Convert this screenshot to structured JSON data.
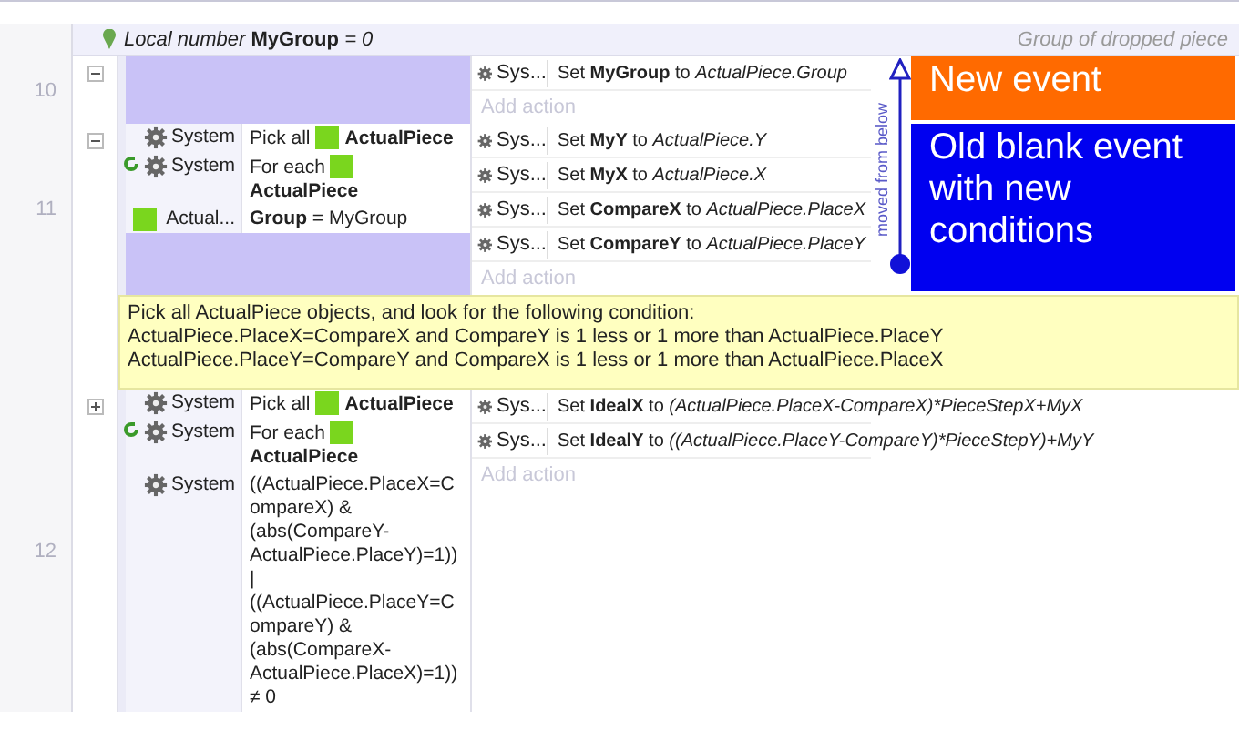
{
  "local_variable": {
    "label": "Local number",
    "name": "MyGroup",
    "value": "= 0",
    "comment": "Group of dropped piece"
  },
  "events": [
    {
      "kind": "event",
      "number": "10",
      "expanded": true,
      "actions": [
        {
          "object": "Sys...",
          "verb": "Set",
          "target": "MyGroup",
          "to": "to",
          "value": "ActualPiece.Group"
        }
      ],
      "add_action": "Add action",
      "note": {
        "kind": "orange",
        "text": "New event"
      }
    },
    {
      "kind": "event",
      "number": "11",
      "expanded": true,
      "conditions": [
        {
          "kind": "system",
          "object": "System",
          "loop": false,
          "prefix": "Pick all",
          "param": "ActualPiece"
        },
        {
          "kind": "system",
          "object": "System",
          "loop": true,
          "prefix": "For each",
          "param": "ActualPiece"
        },
        {
          "kind": "sprite",
          "object": "Actual...",
          "loop": false,
          "text": "**Group** = MyGroup"
        }
      ],
      "actions": [
        {
          "object": "Sys...",
          "verb": "Set",
          "target": "MyY",
          "to": "to",
          "value": "ActualPiece.Y"
        },
        {
          "object": "Sys...",
          "verb": "Set",
          "target": "MyX",
          "to": "to",
          "value": "ActualPiece.X"
        },
        {
          "object": "Sys...",
          "verb": "Set",
          "target": "CompareX",
          "to": "to",
          "value": "ActualPiece.PlaceX"
        },
        {
          "object": "Sys...",
          "verb": "Set",
          "target": "CompareY",
          "to": "to",
          "value": "ActualPiece.PlaceY"
        }
      ],
      "add_action": "Add action",
      "note": {
        "kind": "blue",
        "text": "Old blank event with new conditions"
      }
    },
    {
      "kind": "comment",
      "lines": [
        "Pick all ActualPiece objects, and look for the following condition:",
        "ActualPiece.PlaceX=CompareX and CompareY is 1 less or 1 more than ActualPiece.PlaceY",
        "ActualPiece.PlaceY=CompareY and CompareX is 1 less or 1 more than ActualPiece.PlaceX"
      ]
    },
    {
      "kind": "event",
      "number": "12",
      "expanded": false,
      "conditions": [
        {
          "kind": "system",
          "object": "System",
          "loop": false,
          "prefix": "Pick all",
          "param": "ActualPiece"
        },
        {
          "kind": "system",
          "object": "System",
          "loop": true,
          "prefix": "For each",
          "param": "ActualPiece"
        },
        {
          "kind": "system",
          "object": "System",
          "loop": false,
          "text": "((ActualPiece.PlaceX=CompareX) & (abs(CompareY-ActualPiece.PlaceY)=1)) | ((ActualPiece.PlaceY=CompareY) & (abs(CompareX-ActualPiece.PlaceX)=1)) ≠ 0"
        }
      ],
      "actions": [
        {
          "object": "Sys...",
          "verb": "Set",
          "target": "IdealX",
          "to": "to",
          "value": "(ActualPiece.PlaceX-CompareX)*PieceStepX+MyX"
        },
        {
          "object": "Sys...",
          "verb": "Set",
          "target": "IdealY",
          "to": "to",
          "value": "((ActualPiece.PlaceY-CompareY)*PieceStepY)+MyY"
        }
      ],
      "add_action": "Add action"
    }
  ],
  "moved_label": "moved from below"
}
